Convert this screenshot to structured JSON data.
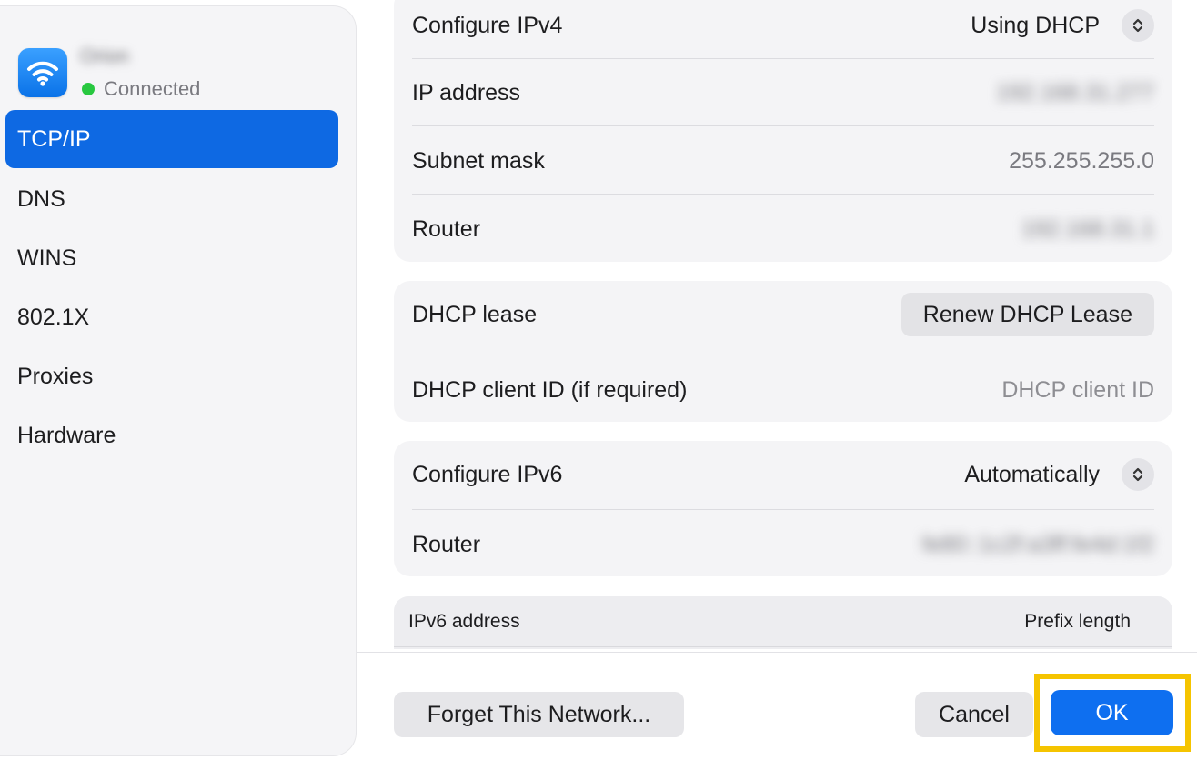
{
  "sidebar": {
    "network_name": "Orion",
    "status": "Connected",
    "status_color": "#28c840",
    "icon": "wifi-icon",
    "items": [
      {
        "label": "TCP/IP",
        "active": true
      },
      {
        "label": "DNS"
      },
      {
        "label": "WINS"
      },
      {
        "label": "802.1X"
      },
      {
        "label": "Proxies"
      },
      {
        "label": "Hardware"
      }
    ]
  },
  "ipv4": {
    "configure_label": "Configure IPv4",
    "configure_value": "Using DHCP",
    "ip_label": "IP address",
    "ip_value": "192.168.31.277",
    "subnet_label": "Subnet mask",
    "subnet_value": "255.255.255.0",
    "router_label": "Router",
    "router_value": "192.168.31.1"
  },
  "dhcp": {
    "lease_label": "DHCP lease",
    "renew_button": "Renew DHCP Lease",
    "client_id_label": "DHCP client ID (if required)",
    "client_id_placeholder": "DHCP client ID"
  },
  "ipv6": {
    "configure_label": "Configure IPv6",
    "configure_value": "Automatically",
    "router_label": "Router",
    "router_value": "fe80::1c2f:a3ff:fe4d:1f2"
  },
  "ipv6_table": {
    "columns": [
      "IPv6 address",
      "Prefix length"
    ]
  },
  "footer": {
    "forget_button": "Forget This Network...",
    "cancel_button": "Cancel",
    "ok_button": "OK",
    "accent_color": "#0e6ff0",
    "highlight_color": "#f5c400"
  }
}
